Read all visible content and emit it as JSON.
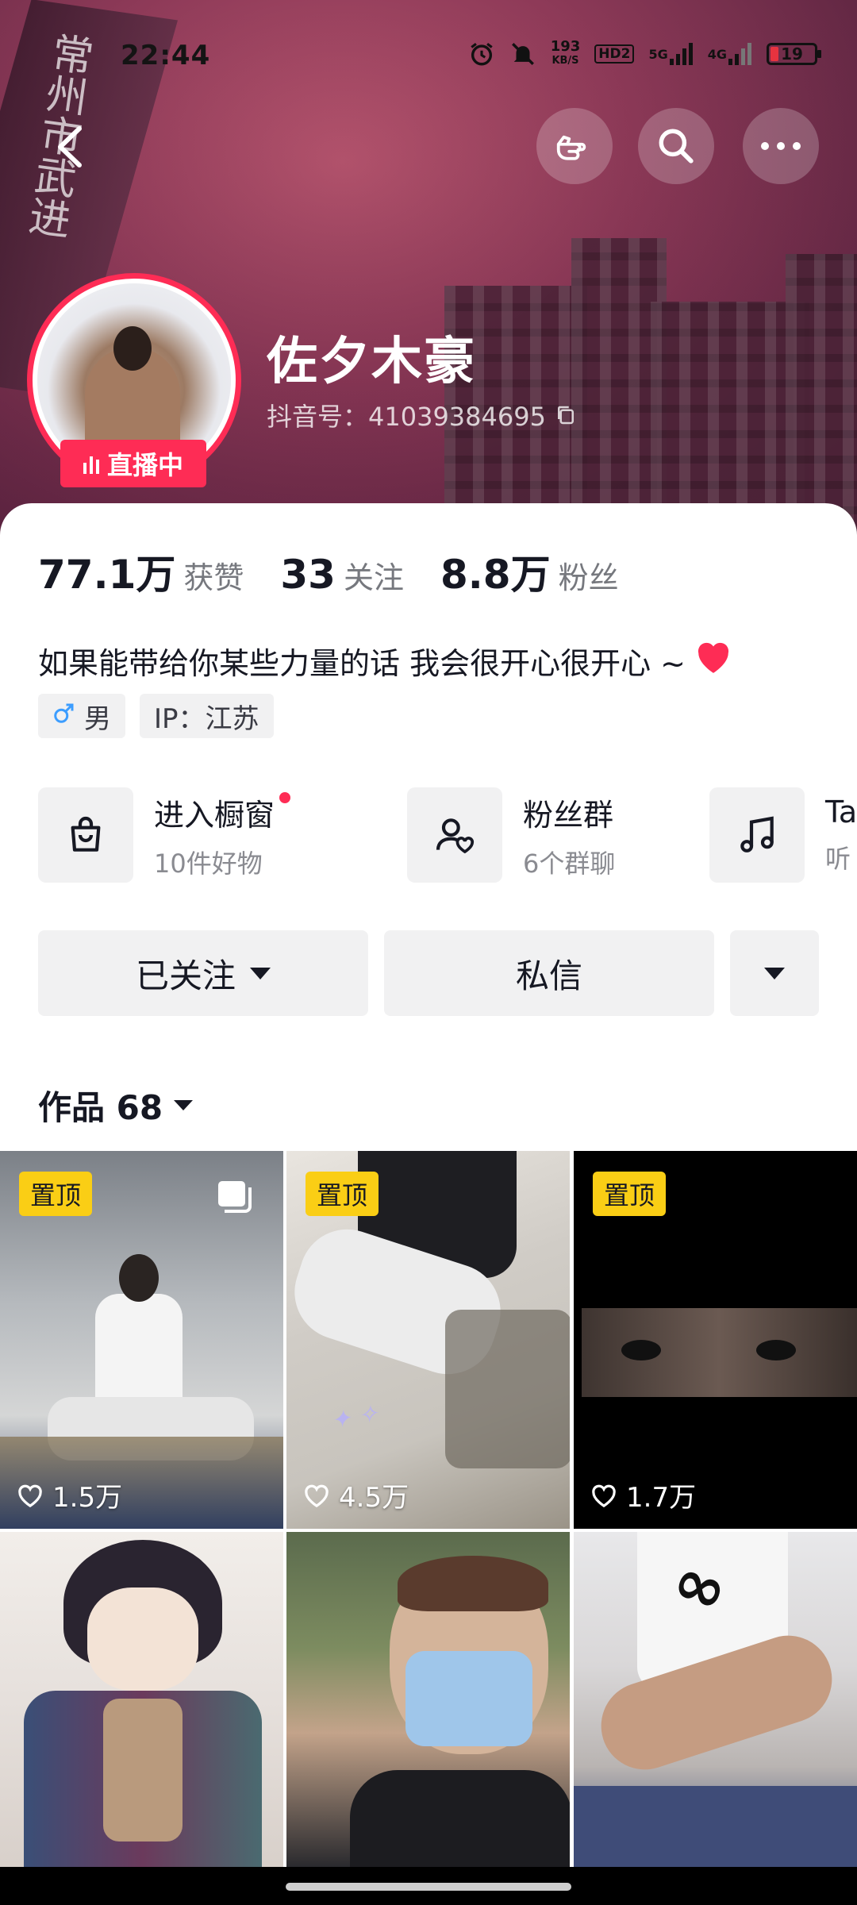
{
  "status_bar": {
    "time": "22:44",
    "net_speed_value": "193",
    "net_speed_unit": "KB/S",
    "hd_label": "HD2",
    "net_5g": "5G",
    "net_4g": "4G",
    "battery": "19"
  },
  "profile": {
    "name": "佐夕木豪",
    "douyin_id": "抖音号：41039384695",
    "live_badge": "直播中",
    "cover_text": "常州市武进"
  },
  "stats": [
    {
      "num": "77.1万",
      "label": "获赞"
    },
    {
      "num": "33",
      "label": "关注"
    },
    {
      "num": "8.8万",
      "label": "粉丝"
    }
  ],
  "bio": "如果能带给你某些力量的话 我会很开心很开心 ~",
  "tags": {
    "gender": "男",
    "ip": "IP：江苏"
  },
  "entries": [
    {
      "title": "进入橱窗",
      "subtitle": "10件好物"
    },
    {
      "title": "粉丝群",
      "subtitle": "6个群聊"
    },
    {
      "title": "Ta",
      "subtitle": "听"
    }
  ],
  "actions": {
    "follow": "已关注",
    "message": "私信"
  },
  "works": {
    "label": "作品 68"
  },
  "videos": [
    {
      "pinned": "置顶",
      "likes": "1.5万"
    },
    {
      "pinned": "置顶",
      "likes": "4.5万"
    },
    {
      "pinned": "置顶",
      "likes": "1.7万"
    },
    {
      "pinned": "",
      "likes": ""
    },
    {
      "pinned": "",
      "likes": ""
    },
    {
      "pinned": "",
      "likes": ""
    }
  ],
  "colors": {
    "accent": "#fe2c55",
    "pin_badge": "#face15",
    "muted_text": "#76787e"
  }
}
